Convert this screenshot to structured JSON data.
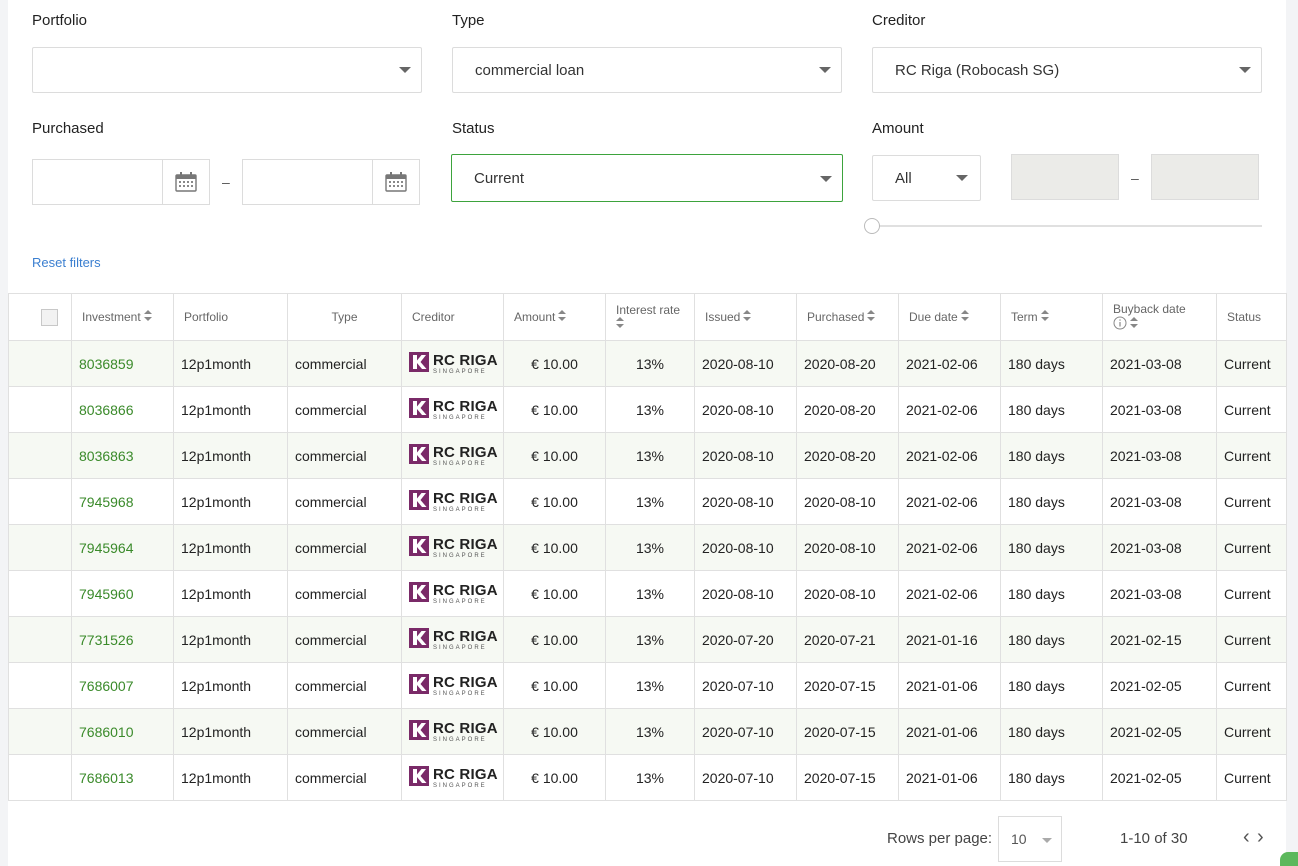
{
  "filters": {
    "portfolio": {
      "label": "Portfolio",
      "value": ""
    },
    "type": {
      "label": "Type",
      "value": "commercial loan"
    },
    "creditor": {
      "label": "Creditor",
      "value": "RC Riga (Robocash SG)"
    },
    "purchased": {
      "label": "Purchased",
      "from": "",
      "to": "",
      "dash": "–"
    },
    "status": {
      "label": "Status",
      "value": "Current"
    },
    "amount": {
      "label": "Amount",
      "mode": "All",
      "dash": "–"
    },
    "reset_label": "Reset filters"
  },
  "table": {
    "headers": {
      "investment": "Investment",
      "portfolio": "Portfolio",
      "type": "Type",
      "creditor": "Creditor",
      "amount": "Amount",
      "interest_rate": "Interest rate",
      "issued": "Issued",
      "purchased": "Purchased",
      "due_date": "Due date",
      "term": "Term",
      "buyback_date": "Buyback date",
      "status": "Status"
    },
    "creditor_logo": {
      "big": "RC RIGA",
      "small": "SINGAPORE",
      "color": "#7a2a68"
    },
    "rows": [
      {
        "investment": "8036859",
        "portfolio": "12p1month",
        "type": "commercial",
        "amount": "€ 10.00",
        "rate": "13%",
        "issued": "2020-08-10",
        "purchased": "2020-08-20",
        "due": "2021-02-06",
        "term": "180 days",
        "buyback": "2021-03-08",
        "status": "Current"
      },
      {
        "investment": "8036866",
        "portfolio": "12p1month",
        "type": "commercial",
        "amount": "€ 10.00",
        "rate": "13%",
        "issued": "2020-08-10",
        "purchased": "2020-08-20",
        "due": "2021-02-06",
        "term": "180 days",
        "buyback": "2021-03-08",
        "status": "Current"
      },
      {
        "investment": "8036863",
        "portfolio": "12p1month",
        "type": "commercial",
        "amount": "€ 10.00",
        "rate": "13%",
        "issued": "2020-08-10",
        "purchased": "2020-08-20",
        "due": "2021-02-06",
        "term": "180 days",
        "buyback": "2021-03-08",
        "status": "Current"
      },
      {
        "investment": "7945968",
        "portfolio": "12p1month",
        "type": "commercial",
        "amount": "€ 10.00",
        "rate": "13%",
        "issued": "2020-08-10",
        "purchased": "2020-08-10",
        "due": "2021-02-06",
        "term": "180 days",
        "buyback": "2021-03-08",
        "status": "Current"
      },
      {
        "investment": "7945964",
        "portfolio": "12p1month",
        "type": "commercial",
        "amount": "€ 10.00",
        "rate": "13%",
        "issued": "2020-08-10",
        "purchased": "2020-08-10",
        "due": "2021-02-06",
        "term": "180 days",
        "buyback": "2021-03-08",
        "status": "Current"
      },
      {
        "investment": "7945960",
        "portfolio": "12p1month",
        "type": "commercial",
        "amount": "€ 10.00",
        "rate": "13%",
        "issued": "2020-08-10",
        "purchased": "2020-08-10",
        "due": "2021-02-06",
        "term": "180 days",
        "buyback": "2021-03-08",
        "status": "Current"
      },
      {
        "investment": "7731526",
        "portfolio": "12p1month",
        "type": "commercial",
        "amount": "€ 10.00",
        "rate": "13%",
        "issued": "2020-07-20",
        "purchased": "2020-07-21",
        "due": "2021-01-16",
        "term": "180 days",
        "buyback": "2021-02-15",
        "status": "Current"
      },
      {
        "investment": "7686007",
        "portfolio": "12p1month",
        "type": "commercial",
        "amount": "€ 10.00",
        "rate": "13%",
        "issued": "2020-07-10",
        "purchased": "2020-07-15",
        "due": "2021-01-06",
        "term": "180 days",
        "buyback": "2021-02-05",
        "status": "Current"
      },
      {
        "investment": "7686010",
        "portfolio": "12p1month",
        "type": "commercial",
        "amount": "€ 10.00",
        "rate": "13%",
        "issued": "2020-07-10",
        "purchased": "2020-07-15",
        "due": "2021-01-06",
        "term": "180 days",
        "buyback": "2021-02-05",
        "status": "Current"
      },
      {
        "investment": "7686013",
        "portfolio": "12p1month",
        "type": "commercial",
        "amount": "€ 10.00",
        "rate": "13%",
        "issued": "2020-07-10",
        "purchased": "2020-07-15",
        "due": "2021-01-06",
        "term": "180 days",
        "buyback": "2021-02-05",
        "status": "Current"
      }
    ]
  },
  "pagination": {
    "rows_per_page_label": "Rows per page:",
    "rows_per_page": "10",
    "range": "1-10 of 30",
    "prev": "‹",
    "next": "›"
  },
  "colors": {
    "accent_green": "#3a8a2a",
    "link_blue": "#3b7fd0",
    "row_stripe": "#f6f9f3"
  }
}
